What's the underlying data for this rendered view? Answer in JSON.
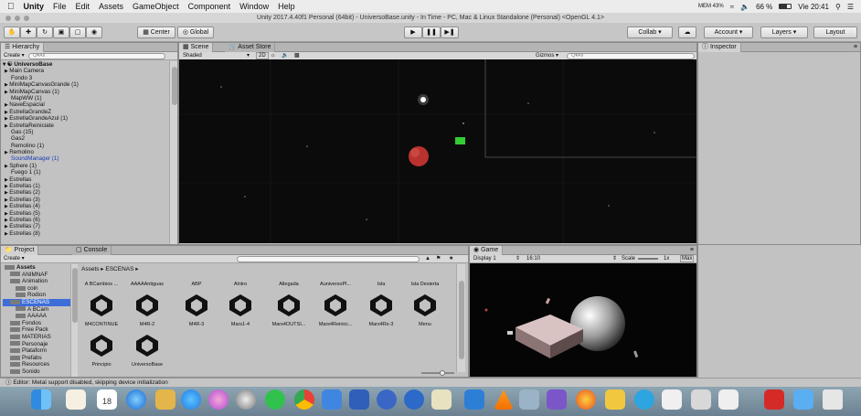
{
  "menubar": {
    "app_name": "Unity",
    "items": [
      "File",
      "Edit",
      "Assets",
      "GameObject",
      "Component",
      "Window",
      "Help"
    ],
    "battery_label": "66 %",
    "clock": "Vie 20:41",
    "cpu_label": "MEM 43%"
  },
  "window": {
    "title": "Unity 2017.4.40f1 Personal (64bit) - UniversoBase.unity - In Time - PC, Mac & Linux Standalone (Personal) <OpenGL 4.1>"
  },
  "toolbar": {
    "center_label": "Center",
    "global_label": "Global",
    "collab_label": "Collab ▾",
    "account_label": "Account ▾",
    "layers_label": "Layers ▾",
    "layout_label": "Layout"
  },
  "hierarchy": {
    "tab_label": "Hierarchy",
    "create_label": "Create ▾",
    "search_placeholder": "Q▾All",
    "scene_name": "UniversoBase",
    "items": [
      {
        "label": "Main Camera",
        "arrow": true,
        "blue": false
      },
      {
        "label": "Fondo 3",
        "arrow": false,
        "blue": false
      },
      {
        "label": "MiniMapCanvasGrande (1)",
        "arrow": true,
        "blue": false
      },
      {
        "label": "MiniMapCanvas (1)",
        "arrow": true,
        "blue": false
      },
      {
        "label": "MapWW (1)",
        "arrow": false,
        "blue": false
      },
      {
        "label": "NaveEspacial",
        "arrow": true,
        "blue": false
      },
      {
        "label": "EstrellaGrandeZ",
        "arrow": true,
        "blue": false
      },
      {
        "label": "EstrellaGrandeAzul (1)",
        "arrow": true,
        "blue": false
      },
      {
        "label": "EstrellaReiniciate",
        "arrow": true,
        "blue": false
      },
      {
        "label": "Gas (15)",
        "arrow": false,
        "blue": false
      },
      {
        "label": "Gas2",
        "arrow": false,
        "blue": false
      },
      {
        "label": "Remolino (1)",
        "arrow": false,
        "blue": false
      },
      {
        "label": "Remolino",
        "arrow": true,
        "blue": false
      },
      {
        "label": "SoundManager (1)",
        "arrow": false,
        "blue": true
      },
      {
        "label": "Sphere (1)",
        "arrow": true,
        "blue": false
      },
      {
        "label": "Fuego 1 (1)",
        "arrow": false,
        "blue": false
      },
      {
        "label": "Estrellas",
        "arrow": true,
        "blue": false
      },
      {
        "label": "Estrellas (1)",
        "arrow": true,
        "blue": false
      },
      {
        "label": "Estrellas (2)",
        "arrow": true,
        "blue": false
      },
      {
        "label": "Estrellas (3)",
        "arrow": true,
        "blue": false
      },
      {
        "label": "Estrellas (4)",
        "arrow": true,
        "blue": false
      },
      {
        "label": "Estrellas (5)",
        "arrow": true,
        "blue": false
      },
      {
        "label": "Estrellas (6)",
        "arrow": true,
        "blue": false
      },
      {
        "label": "Estrellas (7)",
        "arrow": true,
        "blue": false
      },
      {
        "label": "Estrellas (8)",
        "arrow": true,
        "blue": false
      }
    ]
  },
  "scene": {
    "tab_label": "Scene",
    "asset_store_label": "Asset Store",
    "shading_label": "Shaded",
    "mode_2d_label": "2D",
    "gizmos_label": "Gizmos ▾",
    "search_placeholder": "Q▾All"
  },
  "inspector": {
    "tab_label": "Inspector"
  },
  "project": {
    "tab_label": "Project",
    "console_label": "Console",
    "create_label": "Create ▾",
    "breadcrumb": "Assets ▸ ESCENAS ▸",
    "tree": [
      {
        "label": "Assets",
        "indent": 0,
        "bold": true
      },
      {
        "label": "ANIMNAF",
        "indent": 1,
        "bold": false
      },
      {
        "label": "Animation",
        "indent": 1,
        "bold": false
      },
      {
        "label": "coin",
        "indent": 2,
        "bold": false
      },
      {
        "label": "Rodion",
        "indent": 2,
        "bold": false
      },
      {
        "label": "ESCENAS",
        "indent": 1,
        "bold": false,
        "selected": true
      },
      {
        "label": "A BCam",
        "indent": 2,
        "bold": false
      },
      {
        "label": "AAAAA",
        "indent": 2,
        "bold": false
      },
      {
        "label": "Fondos",
        "indent": 1,
        "bold": false
      },
      {
        "label": "Free Pack",
        "indent": 1,
        "bold": false
      },
      {
        "label": "MATERIAS",
        "indent": 1,
        "bold": false
      },
      {
        "label": "Personaje",
        "indent": 1,
        "bold": false
      },
      {
        "label": "Plataform",
        "indent": 1,
        "bold": false
      },
      {
        "label": "Prefabs",
        "indent": 1,
        "bold": false
      },
      {
        "label": "Resources",
        "indent": 1,
        "bold": false
      },
      {
        "label": "Sonido",
        "indent": 1,
        "bold": false
      }
    ],
    "folder_row": [
      "A BCambios ...",
      "AAAAAntiguas",
      "ABP",
      "Alntro",
      "Allegada",
      "AuniversoPl...",
      "Isla",
      "Isla Desierta"
    ],
    "scene_row1": [
      "M4CONTINUE",
      "M4R-2",
      "M4R-3",
      "Mars1-4",
      "Mars4OUTSI...",
      "Mars4Reinici...",
      "Mars4Rx-3",
      "Menu"
    ],
    "scene_row2": [
      "Principio",
      "UniversoBase"
    ]
  },
  "game": {
    "tab_label": "Game",
    "display_label": "Display 1",
    "aspect_label": "16:10",
    "scale_label": "Scale",
    "scale_value": "1x",
    "max_label": "Max"
  },
  "status": {
    "message": "Editor: Metal support disabled, skipping device initialization"
  },
  "dock": {
    "calendar_day": "18"
  },
  "colors": {
    "panel_bg": "#c2c2c2",
    "scene_bg": "#0b0b0b",
    "selection_blue": "#3d6ed8",
    "gizmo_green": "#33cc33",
    "planet_red": "#b9322e"
  }
}
